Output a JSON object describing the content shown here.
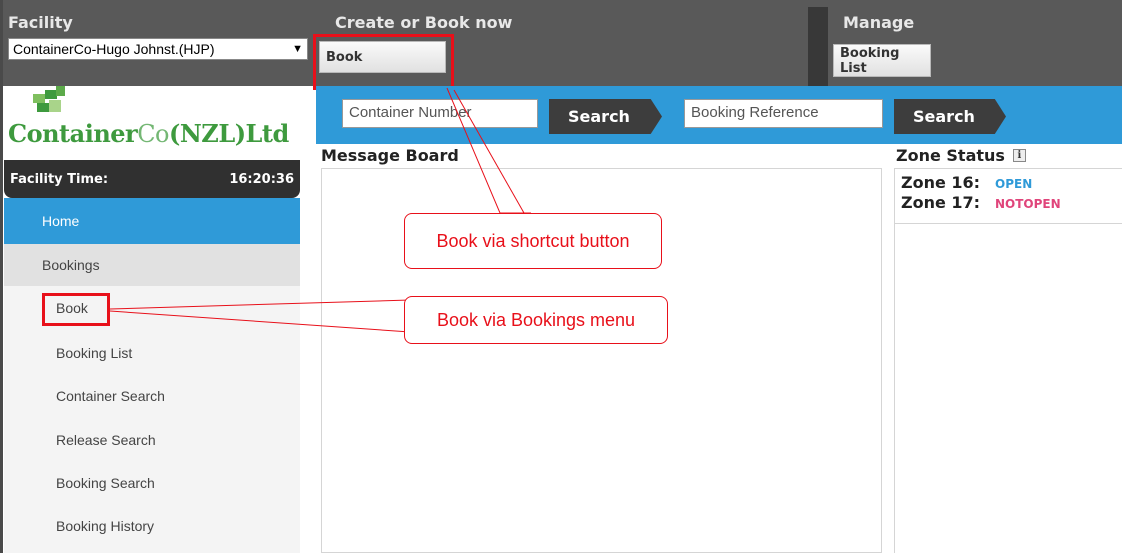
{
  "header": {
    "facility_label": "Facility",
    "facility_selected": "ContainerCo-Hugo Johnst.(HJP)",
    "create_label": "Create or Book now",
    "book_button": "Book",
    "manage_label": "Manage",
    "booking_list_button": "Booking List"
  },
  "search": {
    "container_placeholder": "Container Number",
    "search_button_1": "Search",
    "booking_ref_placeholder": "Booking Reference",
    "search_button_2": "Search"
  },
  "logo": {
    "name_part1": "Container",
    "name_part2": "Co",
    "name_part3": "(NZL)Ltd"
  },
  "facility_time": {
    "label": "Facility Time:",
    "value": "16:20:36"
  },
  "sidebar": {
    "items": [
      {
        "label": "Home"
      },
      {
        "label": "Bookings"
      },
      {
        "label": "Book"
      },
      {
        "label": "Booking List"
      },
      {
        "label": "Container Search"
      },
      {
        "label": "Release Search"
      },
      {
        "label": "Booking Search"
      },
      {
        "label": "Booking History"
      }
    ]
  },
  "message_board": {
    "title": "Message Board"
  },
  "zone_status": {
    "title": "Zone Status",
    "info_glyph": "i",
    "zones": [
      {
        "name": "Zone 16:",
        "status": "OPEN",
        "color": "#2f9ad8"
      },
      {
        "name": "Zone 17:",
        "status": "NOTOPEN",
        "color": "#e0457b"
      }
    ]
  },
  "annotations": {
    "callout_shortcut": "Book via shortcut button",
    "callout_menu": "Book via Bookings menu",
    "highlight_color": "#e8101a"
  },
  "colors": {
    "header_bg": "#595959",
    "accent_blue": "#2f9ad8",
    "logo_green": "#3e9a3e"
  }
}
